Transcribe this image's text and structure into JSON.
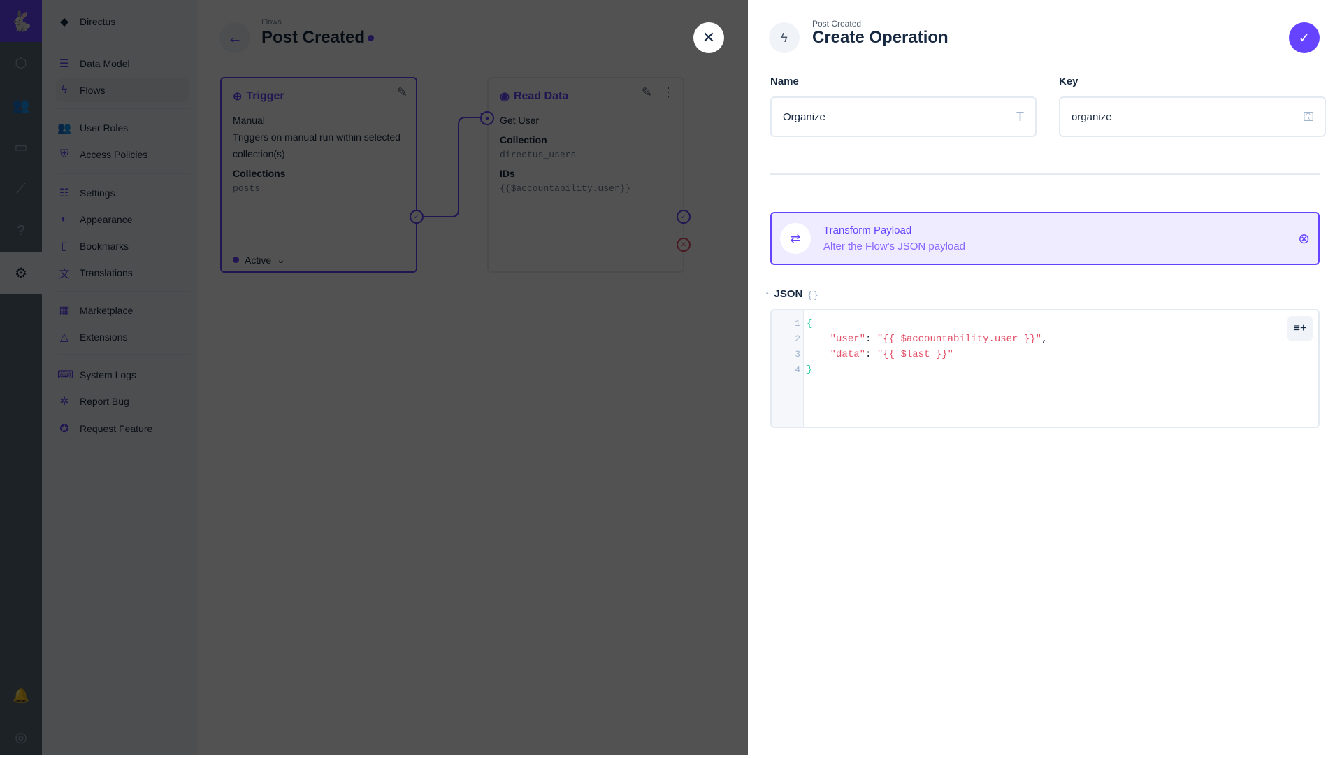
{
  "rail": {
    "items": [
      "content",
      "users",
      "files",
      "insights",
      "help",
      "settings"
    ],
    "bottom": [
      "notifications",
      "user"
    ]
  },
  "sidebar": {
    "project": "Directus",
    "items": [
      {
        "label": "Data Model",
        "icon": "database-icon"
      },
      {
        "label": "Flows",
        "icon": "bolt-icon"
      },
      {
        "label": "User Roles",
        "icon": "users-icon"
      },
      {
        "label": "Access Policies",
        "icon": "shield-icon"
      },
      {
        "label": "Settings",
        "icon": "sliders-icon"
      },
      {
        "label": "Appearance",
        "icon": "palette-icon"
      },
      {
        "label": "Bookmarks",
        "icon": "bookmark-icon"
      },
      {
        "label": "Translations",
        "icon": "translate-icon"
      },
      {
        "label": "Marketplace",
        "icon": "store-icon"
      },
      {
        "label": "Extensions",
        "icon": "shapes-icon"
      },
      {
        "label": "System Logs",
        "icon": "terminal-icon"
      },
      {
        "label": "Report Bug",
        "icon": "bug-icon"
      },
      {
        "label": "Request Feature",
        "icon": "verified-icon"
      }
    ]
  },
  "header": {
    "breadcrumb": "Flows",
    "title": "Post Created"
  },
  "trigger": {
    "title": "Trigger",
    "type": "Manual",
    "desc": "Triggers on manual run within selected collection(s)",
    "collections_label": "Collections",
    "collections": "posts",
    "status": "Active"
  },
  "read": {
    "title": "Read Data",
    "name": "Get User",
    "collection_label": "Collection",
    "collection": "directus_users",
    "ids_label": "IDs",
    "ids": "{{$accountability.user}}"
  },
  "drawer": {
    "breadcrumb": "Post Created",
    "title": "Create Operation",
    "name_label": "Name",
    "name_value": "Organize",
    "key_label": "Key",
    "key_value": "organize",
    "operation": {
      "title": "Transform Payload",
      "desc": "Alter the Flow's JSON payload"
    },
    "json_label": "JSON",
    "json_lines": [
      "{",
      "    \"user\": \"{{ $accountability.user }}\",",
      "    \"data\": \"{{ $last }}\"",
      "}"
    ]
  },
  "colors": {
    "accent": "#6644ff"
  }
}
